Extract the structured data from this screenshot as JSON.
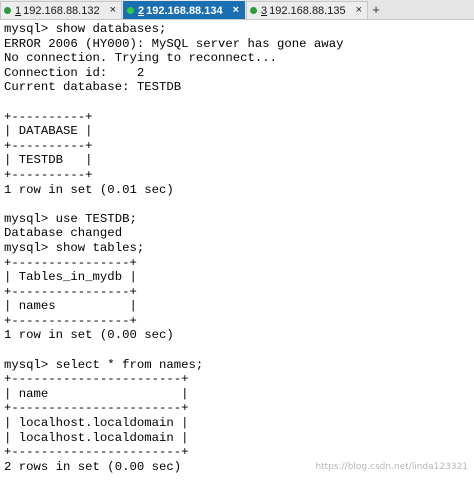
{
  "tabs": [
    {
      "number": "1",
      "host": "192.168.88.132",
      "status_color": "#2e9a3e",
      "active": false
    },
    {
      "number": "2",
      "host": "192.168.88.134",
      "status_color": "#2ecc40",
      "active": true
    },
    {
      "number": "3",
      "host": "192.168.88.135",
      "status_color": "#2e9a3e",
      "active": false
    }
  ],
  "tab_close_label": "×",
  "tab_add_label": "+",
  "terminal": {
    "lines": [
      "mysql> show databases;",
      "ERROR 2006 (HY000): MySQL server has gone away",
      "No connection. Trying to reconnect...",
      "Connection id:    2",
      "Current database: TESTDB",
      "",
      "+----------+",
      "| DATABASE |",
      "+----------+",
      "| TESTDB   |",
      "+----------+",
      "1 row in set (0.01 sec)",
      "",
      "mysql> use TESTDB;",
      "Database changed",
      "mysql> show tables;",
      "+----------------+",
      "| Tables_in_mydb |",
      "+----------------+",
      "| names          |",
      "+----------------+",
      "1 row in set (0.00 sec)",
      "",
      "mysql> select * from names;",
      "+-----------------------+",
      "| name                  |",
      "+-----------------------+",
      "| localhost.localdomain |",
      "| localhost.localdomain |",
      "+-----------------------+",
      "2 rows in set (0.00 sec)"
    ]
  },
  "watermark": "https://blog.csdn.net/linda123321"
}
